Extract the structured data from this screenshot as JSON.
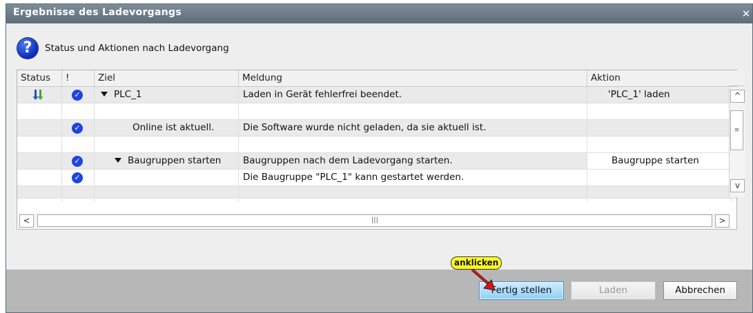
{
  "window": {
    "title": "Ergebnisse des Ladevorgangs",
    "close_glyph": "✕"
  },
  "header": {
    "text": "Status und Aktionen nach Ladevorgang",
    "icon": "question-icon"
  },
  "table": {
    "columns": {
      "status": "Status",
      "bang": "!",
      "ziel": "Ziel",
      "meldung": "Meldung",
      "aktion": "Aktion"
    },
    "rows": [
      {
        "status_icon": "download-icon",
        "check": true,
        "expand": true,
        "ziel": "PLC_1",
        "meldung": "Laden in Gerät fehlerfrei beendet.",
        "aktion": "'PLC_1' laden"
      },
      {
        "status_icon": "",
        "check": false,
        "expand": false,
        "ziel": "",
        "meldung": "",
        "aktion": ""
      },
      {
        "status_icon": "",
        "check": true,
        "expand": false,
        "ziel": "Online ist aktuell.",
        "meldung": "Die Software wurde nicht geladen, da sie aktuell ist.",
        "aktion": ""
      },
      {
        "status_icon": "",
        "check": false,
        "expand": false,
        "ziel": "",
        "meldung": "",
        "aktion": ""
      },
      {
        "status_icon": "",
        "check": true,
        "expand": true,
        "ziel": "Baugruppen starten",
        "meldung": "Baugruppen nach dem Ladevorgang starten.",
        "aktion": "Baugruppe starten"
      },
      {
        "status_icon": "",
        "check": true,
        "expand": false,
        "ziel": "",
        "meldung": "Die Baugruppe \"PLC_1\" kann gestartet werden.",
        "aktion": ""
      }
    ]
  },
  "buttons": {
    "finish": "Fertig stellen",
    "load": "Laden",
    "cancel": "Abbrechen"
  },
  "callout": {
    "text": "anklicken"
  },
  "scroll": {
    "up": "^",
    "down": "v",
    "left": "<",
    "right": ">",
    "vgrip": "≡",
    "hgrip": "|||"
  },
  "colors": {
    "titlebar": "#6b7b87",
    "check": "#1f45dd",
    "callout": "#ffff22",
    "primary_button": "#8fcff5",
    "arrow": "#dd1111"
  }
}
